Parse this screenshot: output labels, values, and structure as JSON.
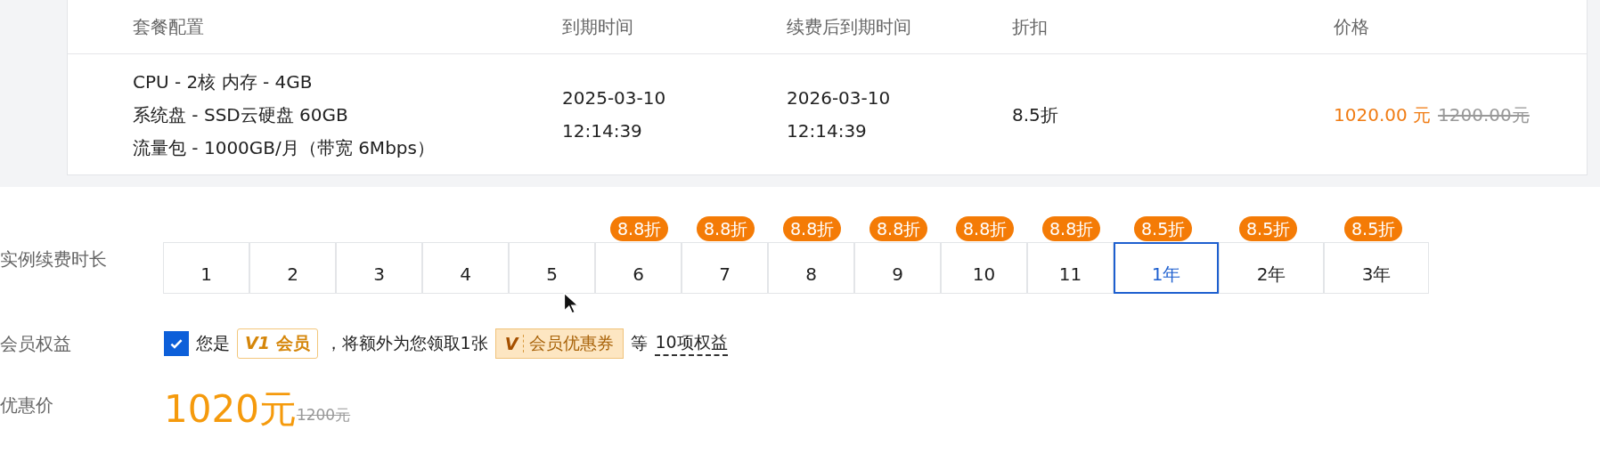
{
  "table": {
    "columns": [
      "套餐配置",
      "到期时间",
      "续费后到期时间",
      "折扣",
      "价格"
    ],
    "row": {
      "config": [
        "CPU - 2核 内存 - 4GB",
        "系统盘 - SSD云硬盘 60GB",
        "流量包 - 1000GB/月（带宽 6Mbps）"
      ],
      "expire": [
        "2025-03-10",
        "12:14:39"
      ],
      "renew_expire": [
        "2026-03-10",
        "12:14:39"
      ],
      "discount": "8.5折",
      "price": "1020.00 元",
      "original_price": "1200.00元"
    }
  },
  "duration": {
    "label": "实例续费时长",
    "options": [
      {
        "label": "1",
        "selected": false
      },
      {
        "label": "2",
        "selected": false
      },
      {
        "label": "3",
        "selected": false
      },
      {
        "label": "4",
        "selected": false
      },
      {
        "label": "5",
        "selected": false
      },
      {
        "label": "6",
        "badge": "8.8折",
        "selected": false
      },
      {
        "label": "7",
        "badge": "8.8折",
        "selected": false
      },
      {
        "label": "8",
        "badge": "8.8折",
        "selected": false
      },
      {
        "label": "9",
        "badge": "8.8折",
        "selected": false
      },
      {
        "label": "10",
        "badge": "8.8折",
        "selected": false
      },
      {
        "label": "11",
        "badge": "8.8折",
        "selected": false
      },
      {
        "label": "1年",
        "badge": "8.5折",
        "selected": true
      },
      {
        "label": "2年",
        "badge": "8.5折",
        "selected": false
      },
      {
        "label": "3年",
        "badge": "8.5折",
        "selected": false
      }
    ]
  },
  "member": {
    "label": "会员权益",
    "checked": true,
    "prefix": "您是",
    "level_badge": {
      "level": "V1",
      "name": "会员"
    },
    "text": "，将额外为您领取1张",
    "coupon": {
      "mark": "V",
      "name": "会员优惠券"
    },
    "suffix": "等",
    "benefits_link": "10项权益"
  },
  "discount_price": {
    "label": "优惠价",
    "price": "1020元",
    "original": "1200元"
  }
}
